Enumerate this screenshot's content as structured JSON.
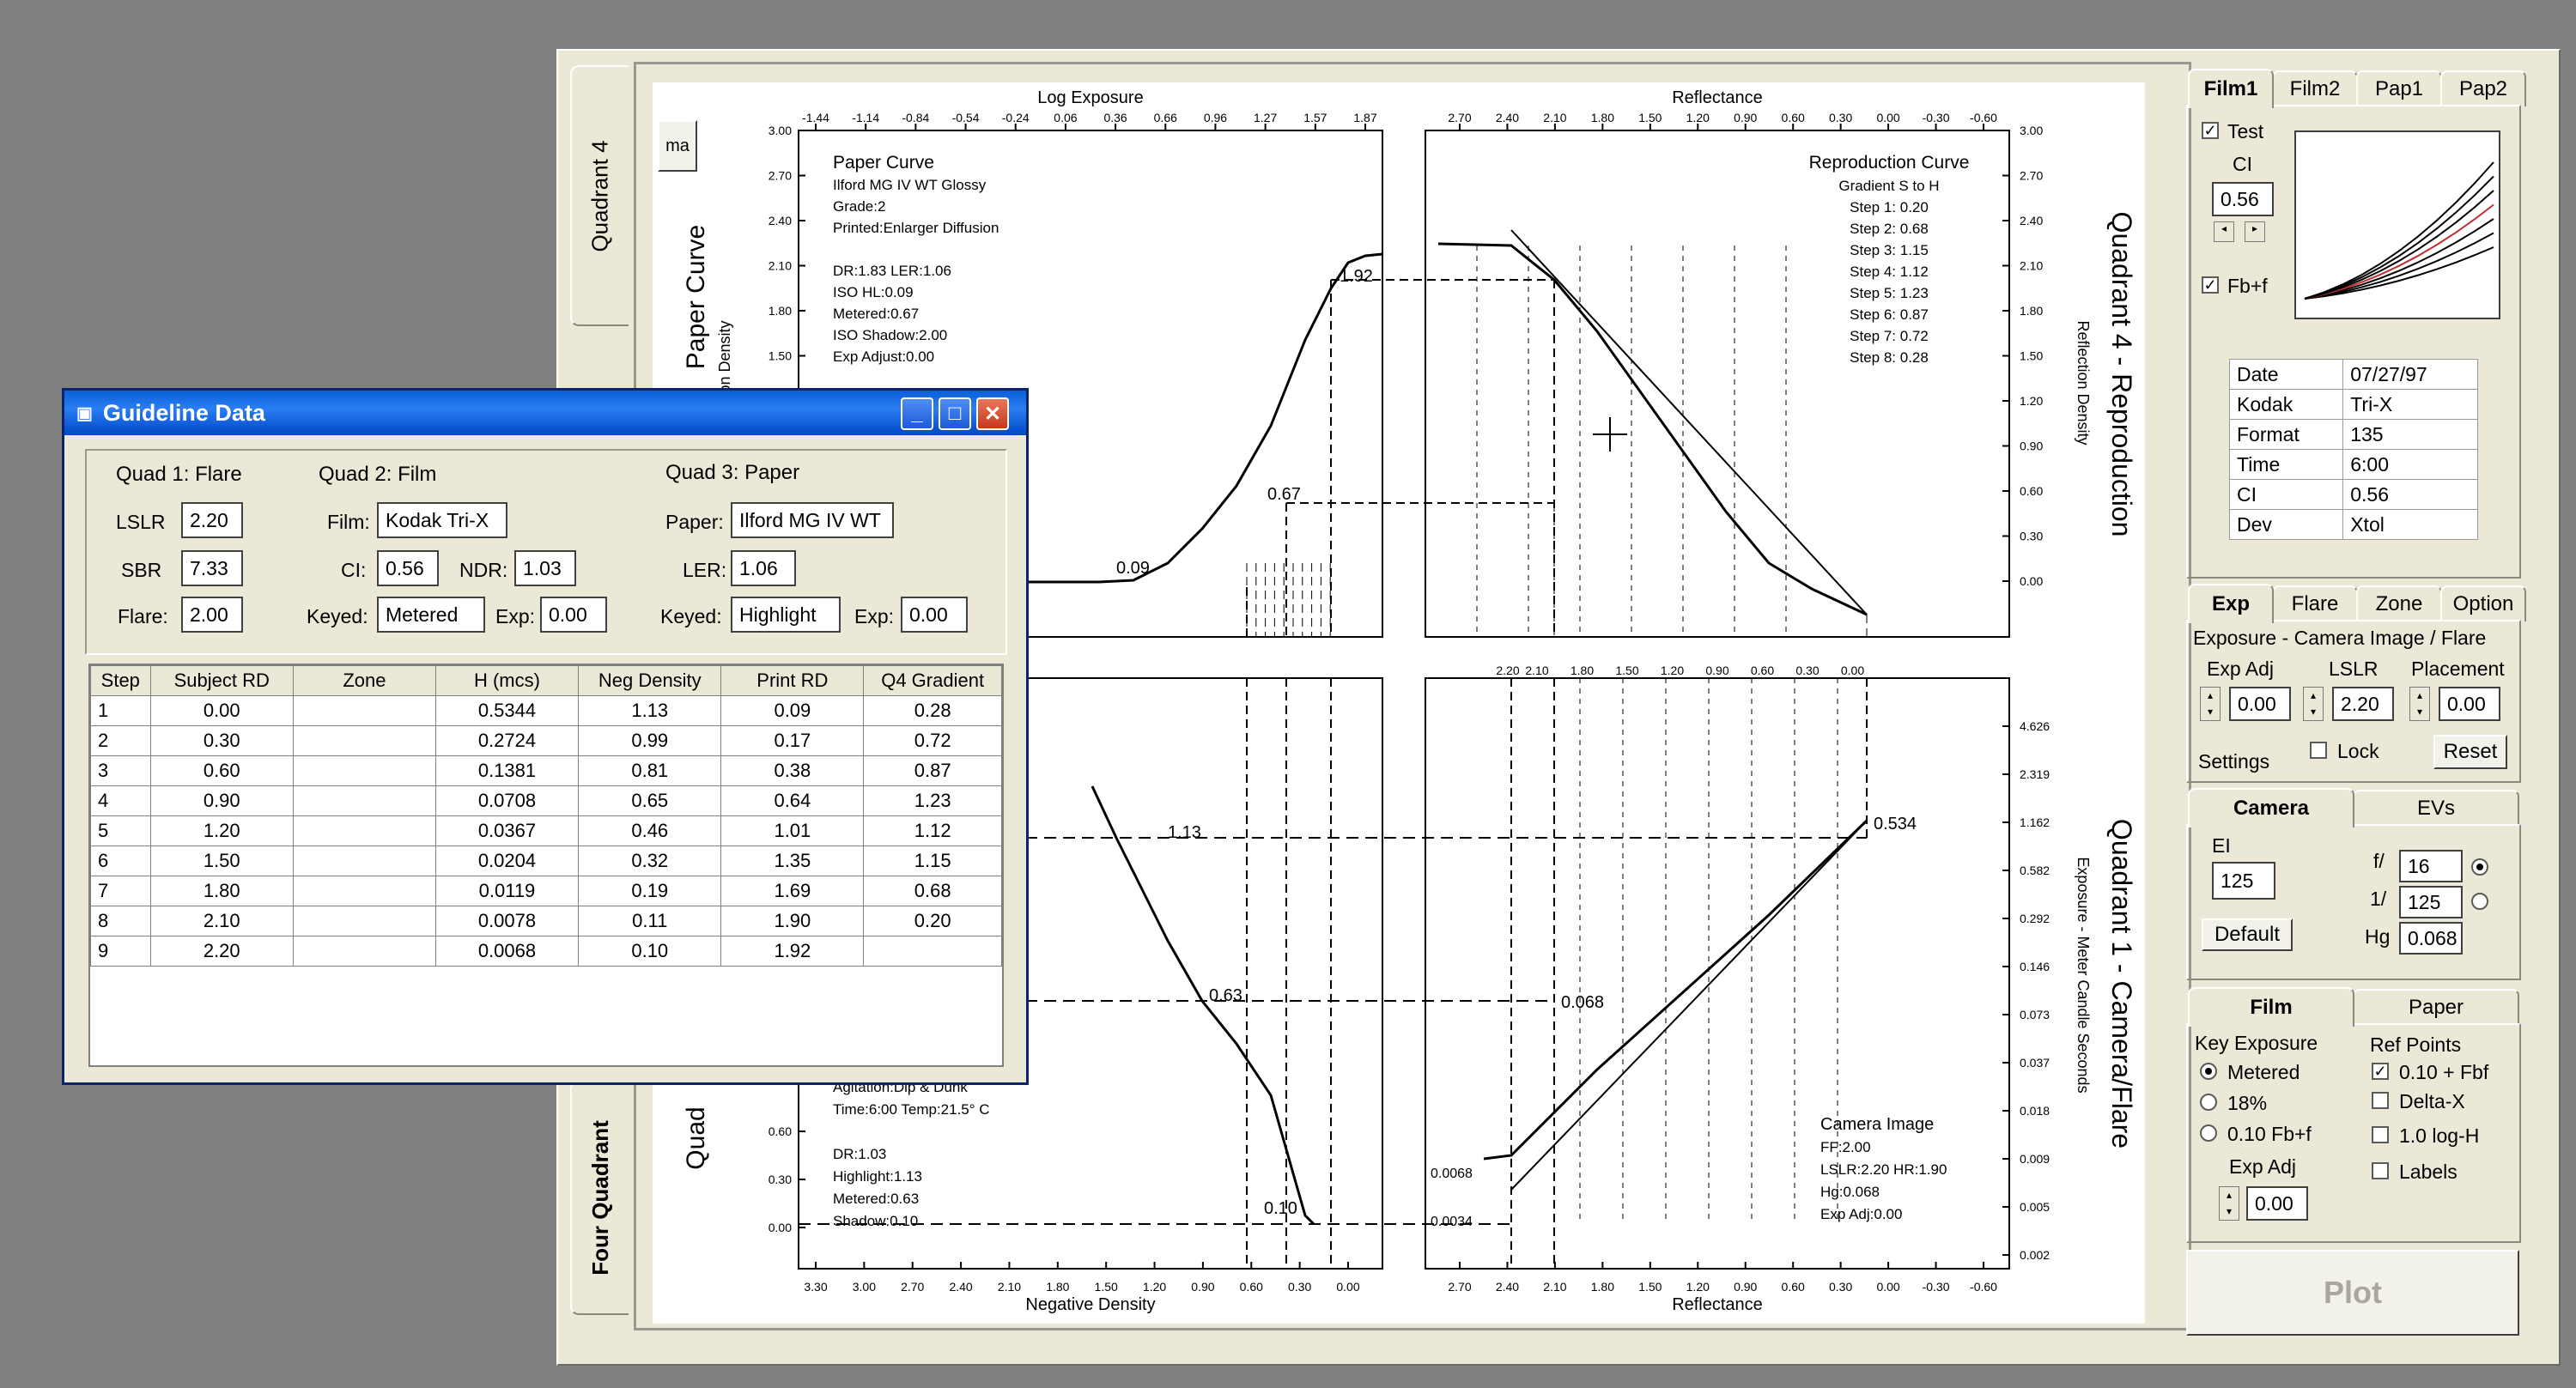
{
  "app": {
    "left_tabs": [
      "Quadrant 4",
      "Four Quadrant"
    ],
    "small_button": "ma"
  },
  "chart": {
    "top_left": {
      "axis_title": "Log Exposure",
      "x_ticks": [
        "-1.44",
        "-1.14",
        "-0.84",
        "-0.54",
        "-0.24",
        "0.06",
        "0.36",
        "0.66",
        "0.96",
        "1.27",
        "1.57",
        "1.87"
      ],
      "y_ticks": [
        "3.00",
        "2.70",
        "2.40",
        "2.10",
        "1.80",
        "1.50"
      ],
      "side_title": "Paper Curve",
      "y_label": "on Density",
      "info": [
        "Paper Curve",
        "Ilford MG IV WT  Glossy",
        "Grade:2",
        "Printed:Enlarger Diffusion",
        "",
        "DR:1.83  LER:1.06",
        "ISO HL:0.09",
        "Metered:0.67",
        "ISO Shadow:2.00",
        "Exp Adjust:0.00"
      ],
      "labels": [
        "1.92",
        "0.67",
        "0.09"
      ]
    },
    "top_right": {
      "axis_title": "Reflectance",
      "x_ticks": [
        "2.70",
        "2.40",
        "2.10",
        "1.80",
        "1.50",
        "1.20",
        "0.90",
        "0.60",
        "0.30",
        "0.00",
        "-0.30",
        "-0.60"
      ],
      "y_ticks": [
        "3.00",
        "2.70",
        "2.40",
        "2.10",
        "1.80",
        "1.50",
        "1.20",
        "0.90",
        "0.60",
        "0.30",
        "0.00"
      ],
      "y_label": "Reflection Density",
      "side_title": "Quadrant 4 - Reproduction",
      "info_title": "Reproduction Curve",
      "info": [
        "Gradient S to H",
        "Step 1: 0.20",
        "Step 2: 0.68",
        "Step 3: 1.15",
        "Step 4: 1.12",
        "Step 5: 1.23",
        "Step 6: 0.87",
        "Step 7: 0.72",
        "Step 8: 0.28"
      ]
    },
    "bottom_left": {
      "axis_title": "Negative Density",
      "x_ticks": [
        "3.30",
        "3.00",
        "2.70",
        "2.40",
        "2.10",
        "1.80",
        "1.50",
        "1.20",
        "0.90",
        "0.60",
        "0.30",
        "0.00"
      ],
      "y_ticks": [
        "0.60",
        "0.30",
        "0.00"
      ],
      "side_title": "Quad",
      "info": [
        "Agitation:Dip & Dunk",
        "Time:6:00  Temp:21.5° C",
        "",
        "DR:1.03",
        "Highlight:1.13",
        "Metered:0.63",
        "Shadow:0.10"
      ],
      "labels": [
        "1.13",
        "0.63",
        "0.10"
      ]
    },
    "bottom_right": {
      "axis_title": "Reflectance",
      "top_ticks": [
        "2.20",
        "2.10",
        "1.80",
        "1.50",
        "1.20",
        "0.90",
        "0.60",
        "0.30",
        "0.00"
      ],
      "x_ticks": [
        "2.70",
        "2.40",
        "2.10",
        "1.80",
        "1.50",
        "1.20",
        "0.90",
        "0.60",
        "0.30",
        "0.00",
        "-0.30",
        "-0.60"
      ],
      "y_ticks": [
        "4.626",
        "2.319",
        "1.162",
        "0.582",
        "0.292",
        "0.146",
        "0.073",
        "0.037",
        "0.018",
        "0.009",
        "0.005",
        "0.002"
      ],
      "y_label": "Exposure - Meter Candle Seconds",
      "side_title": "Quadrant 1 - Camera/Flare",
      "info": [
        "Camera Image",
        "FF:2.00",
        "LSLR:2.20  HR:1.90",
        "Hg:0.068",
        "Exp Adj:0.00"
      ],
      "labels": [
        "0.534",
        "0.068",
        "0.0068",
        "0.0034"
      ]
    }
  },
  "right_panel": {
    "film_tabs": [
      "Film1",
      "Film2",
      "Pap1",
      "Pap2"
    ],
    "test_label": "Test",
    "ci_label": "CI",
    "ci_value": "0.56",
    "fbf_label": "Fb+f",
    "info_rows": [
      [
        "Date",
        "07/27/97"
      ],
      [
        "Kodak",
        "Tri-X"
      ],
      [
        "Format",
        "135"
      ],
      [
        "Time",
        "6:00"
      ],
      [
        "CI",
        "0.56"
      ],
      [
        "Dev",
        "Xtol"
      ]
    ],
    "exp_tabs": [
      "Exp",
      "Flare",
      "Zone",
      "Option"
    ],
    "exp_heading": "Exposure - Camera Image / Flare",
    "exp_adj_label": "Exp Adj",
    "exp_adj_value": "0.00",
    "lslr_label": "LSLR",
    "lslr_value": "2.20",
    "placement_label": "Placement",
    "placement_value": "0.00",
    "settings_label": "Settings",
    "lock_label": "Lock",
    "reset_label": "Reset",
    "camera_tabs": [
      "Camera",
      "EVs"
    ],
    "ei_label": "EI",
    "ei_value": "125",
    "f_label": "f/",
    "f_value": "16",
    "shutter_label": "1/",
    "shutter_value": "125",
    "hg_label": "Hg",
    "hg_value": "0.068",
    "default_label": "Default",
    "film_paper_tabs": [
      "Film",
      "Paper"
    ],
    "key_exposure_label": "Key Exposure",
    "key_options": [
      "Metered",
      "18%",
      "0.10 Fb+f"
    ],
    "ref_points_label": "Ref Points",
    "ref_options": [
      "0.10 + Fbf",
      "Delta-X",
      "1.0 log-H",
      "Labels"
    ],
    "exp_adj2_label": "Exp Adj",
    "exp_adj2_value": "0.00",
    "plot_label": "Plot"
  },
  "dialog": {
    "title": "Guideline Data",
    "quad1_label": "Quad 1: Flare",
    "quad2_label": "Quad 2: Film",
    "quad3_label": "Quad 3: Paper",
    "lslr_label": "LSLR",
    "lslr_value": "2.20",
    "sbr_label": "SBR",
    "sbr_value": "7.33",
    "flare_label": "Flare:",
    "flare_value": "2.00",
    "film_label": "Film:",
    "film_value": "Kodak Tri-X",
    "ci_label": "CI:",
    "ci_value": "0.56",
    "ndr_label": "NDR:",
    "ndr_value": "1.03",
    "keyed_label": "Keyed:",
    "keyed_value": "Metered",
    "exp_label": "Exp:",
    "exp_value": "0.00",
    "paper_label": "Paper:",
    "paper_value": "Ilford MG IV WT",
    "ler_label": "LER:",
    "ler_value": "1.06",
    "keyed3_label": "Keyed:",
    "keyed3_value": "Highlight",
    "exp3_label": "Exp:",
    "exp3_value": "0.00",
    "columns": [
      "Step",
      "Subject RD",
      "Zone",
      "H (mcs)",
      "Neg Density",
      "Print RD",
      "Q4 Gradient"
    ],
    "rows": [
      [
        "1",
        "0.00",
        "",
        "0.5344",
        "1.13",
        "0.09",
        "0.28"
      ],
      [
        "2",
        "0.30",
        "",
        "0.2724",
        "0.99",
        "0.17",
        "0.72"
      ],
      [
        "3",
        "0.60",
        "",
        "0.1381",
        "0.81",
        "0.38",
        "0.87"
      ],
      [
        "4",
        "0.90",
        "",
        "0.0708",
        "0.65",
        "0.64",
        "1.23"
      ],
      [
        "5",
        "1.20",
        "",
        "0.0367",
        "0.46",
        "1.01",
        "1.12"
      ],
      [
        "6",
        "1.50",
        "",
        "0.0204",
        "0.32",
        "1.35",
        "1.15"
      ],
      [
        "7",
        "1.80",
        "",
        "0.0119",
        "0.19",
        "1.69",
        "0.68"
      ],
      [
        "8",
        "2.10",
        "",
        "0.0078",
        "0.11",
        "1.90",
        "0.20"
      ],
      [
        "9",
        "2.20",
        "",
        "0.0068",
        "0.10",
        "1.92",
        ""
      ]
    ]
  }
}
